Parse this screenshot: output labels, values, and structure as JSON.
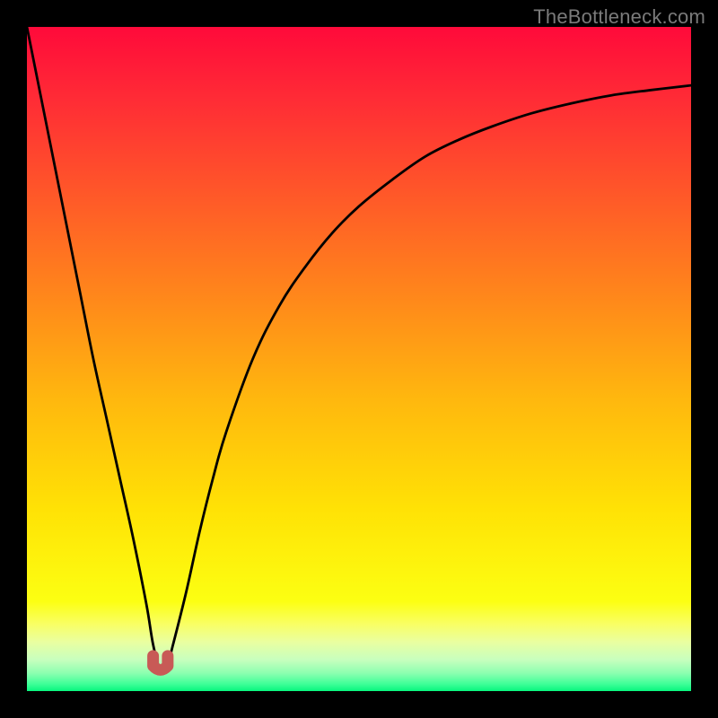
{
  "watermark": {
    "text": "TheBottleneck.com"
  },
  "colors": {
    "frame": "#000000",
    "curve": "#000000",
    "marker": "#c85a56",
    "gradient_top": "#ff0a3a",
    "gradient_mid": "#ffe205",
    "gradient_bottom": "#07f77e"
  },
  "chart_data": {
    "type": "line",
    "title": "",
    "xlabel": "",
    "ylabel": "",
    "xlim": [
      0,
      100
    ],
    "ylim": [
      0,
      100
    ],
    "grid": false,
    "annotations": [
      {
        "text": "TheBottleneck.com",
        "position": "top-right"
      }
    ],
    "series": [
      {
        "name": "bottleneck-curve",
        "x": [
          0,
          2,
          4,
          6,
          8,
          10,
          12,
          14,
          16,
          18,
          19,
          20,
          21,
          22,
          24,
          26,
          28,
          30,
          34,
          38,
          42,
          46,
          50,
          55,
          60,
          65,
          70,
          76,
          82,
          88,
          94,
          100
        ],
        "y": [
          100,
          90,
          80,
          70,
          60,
          50,
          41,
          32,
          23,
          13,
          7,
          3.4,
          3.4,
          7,
          15,
          24,
          32,
          39,
          50,
          58,
          64,
          69,
          73,
          77,
          80.5,
          83,
          85,
          87,
          88.5,
          89.7,
          90.5,
          91.2
        ]
      }
    ],
    "optimum_marker": {
      "x_start": 19,
      "x_end": 21.2,
      "y": 3.4
    }
  }
}
